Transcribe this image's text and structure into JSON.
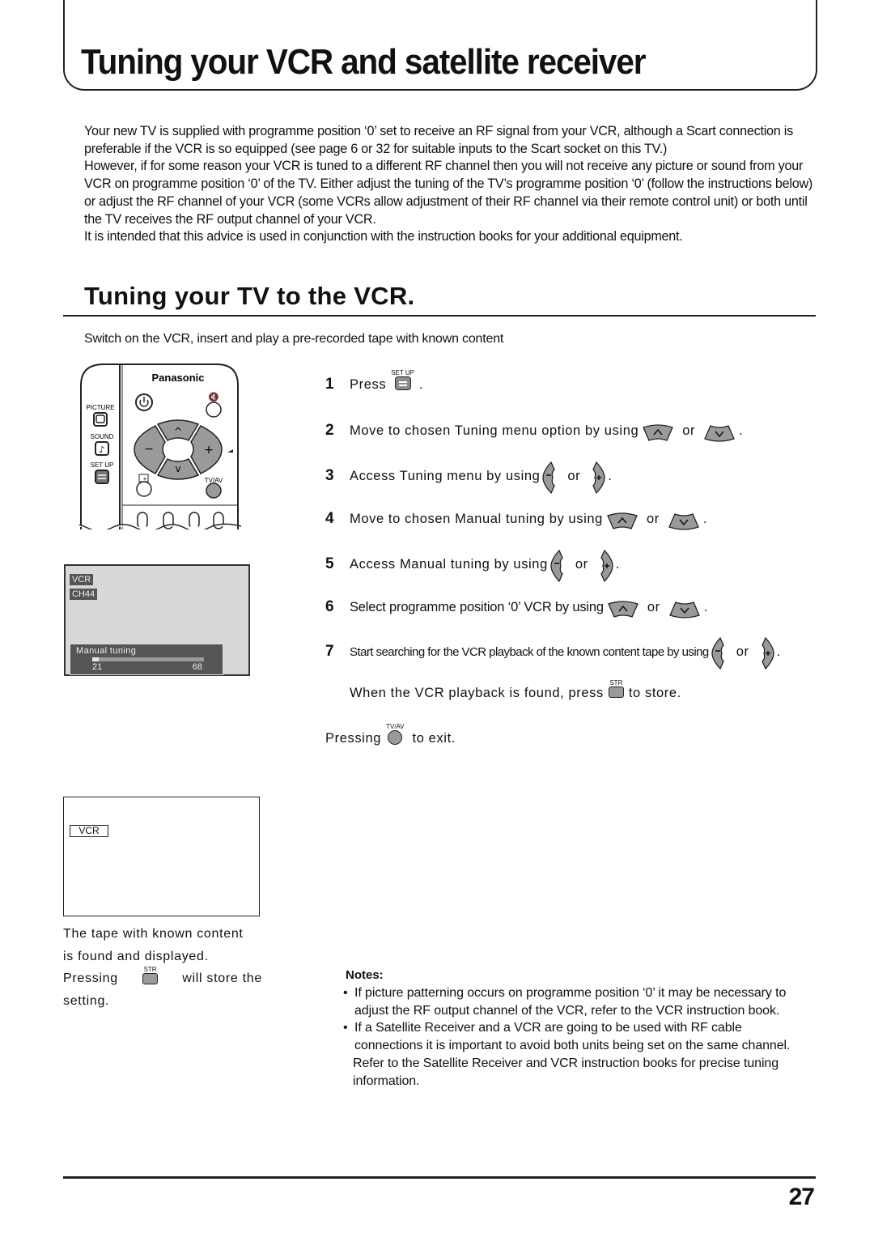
{
  "page_title": "Tuning your VCR and satellite receiver",
  "intro_paragraphs": [
    "Your new TV is supplied with programme position ‘0’ set to receive an RF signal from your VCR, although a Scart connection is preferable if the VCR is so equipped (see page 6 or 32 for suitable inputs to the Scart socket on this TV.)",
    "However, if for some reason your VCR is tuned to a different RF channel then you will not receive any picture or sound from your VCR on programme position ‘0’ of the TV. Either adjust the tuning of the TV’s programme position ‘0’ (follow the instructions below) or adjust the RF channel of your VCR (some VCRs allow adjustment of their RF channel via their remote control unit) or both until the TV receives the RF output channel of your VCR.",
    "It is intended that this advice is used in conjunction with the instruction books for your additional equipment."
  ],
  "section": {
    "title": "Tuning your TV to the VCR.",
    "subtitle": "Switch on the VCR, insert and play a pre-recorded tape with known content"
  },
  "remote": {
    "brand": "Panasonic",
    "labels": {
      "picture": "PICTURE",
      "sound": "SOUND",
      "setup": "SET UP",
      "tvav": "TV/AV"
    }
  },
  "osd_manual_tuning": {
    "source": "VCR",
    "channel": "CH44",
    "title": "Manual tuning",
    "min": "21",
    "max": "68",
    "progress_fraction": 0.06
  },
  "osd_found": {
    "source": "VCR"
  },
  "steps": [
    {
      "num": "1",
      "text": "Press",
      "after": "."
    },
    {
      "num": "2",
      "text": "Move to chosen Tuning menu option by using",
      "or": "or",
      "after": "."
    },
    {
      "num": "3",
      "text": "Access Tuning menu by using",
      "or": "or",
      "after": "."
    },
    {
      "num": "4",
      "text": "Move to chosen Manual tuning by using",
      "or": "or",
      "after": "."
    },
    {
      "num": "5",
      "text": "Access Manual tuning by using",
      "or": "or",
      "after": "."
    },
    {
      "num": "6",
      "text": "Select programme position ‘0’ VCR by using",
      "or": "or",
      "after": "."
    },
    {
      "num": "7",
      "text": "Start searching for the VCR playback of the known content tape by using",
      "or": "or",
      "after": "."
    }
  ],
  "store_line": {
    "before": "When the VCR playback is found, press",
    "after": "to store."
  },
  "exit_line": {
    "before": "Pressing",
    "after": "to exit."
  },
  "button_labels": {
    "setup": "SET UP",
    "str": "STR",
    "tvav": "TV/AV"
  },
  "caption": {
    "line1": "The tape with known content",
    "line2": "is found and displayed.",
    "line3_before": "Pressing",
    "line3_after": "will store the",
    "line4": "setting."
  },
  "notes": {
    "title": "Notes:",
    "items": [
      "If picture patterning occurs on programme position ‘0’ it may be necessary to adjust the RF output channel of the VCR, refer to the VCR instruction book.",
      "If a Satellite Receiver and a VCR are going to be used with RF cable connections it is important to avoid both units being set on the same channel."
    ],
    "extra": "Refer to the Satellite Receiver and VCR instruction books for precise tuning information."
  },
  "page_number": "27"
}
